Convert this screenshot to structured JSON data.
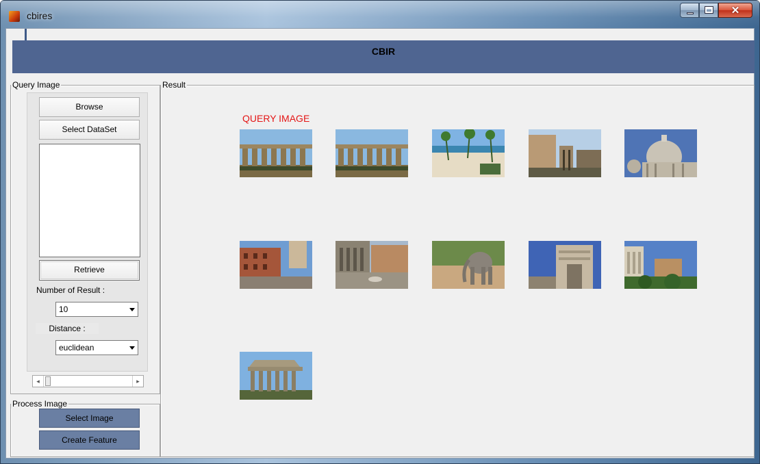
{
  "window": {
    "title": "cbires"
  },
  "banner": {
    "title": "CBIR"
  },
  "query_panel": {
    "label": "Query Image",
    "browse_label": "Browse",
    "select_dataset_label": "Select DataSet",
    "retrieve_label": "Retrieve",
    "number_of_result_label": "Number of Result :",
    "number_of_result_value": "10",
    "distance_label": "Distance :",
    "distance_value": "euclidean"
  },
  "process_panel": {
    "label": "Process Image",
    "select_image_label": "Select Image",
    "create_feature_label": "Create Feature"
  },
  "result_panel": {
    "label": "Result",
    "query_image_label": "QUERY IMAGE",
    "images": [
      {
        "subject": "greek-temple-columns",
        "role": "query"
      },
      {
        "subject": "greek-temple-columns",
        "role": "result"
      },
      {
        "subject": "beach-palm-trees",
        "role": "result"
      },
      {
        "subject": "roman-ruins-street",
        "role": "result"
      },
      {
        "subject": "domed-basilica",
        "role": "result"
      },
      {
        "subject": "spanish-steps-crowd",
        "role": "result"
      },
      {
        "subject": "pantheon-piazza",
        "role": "result"
      },
      {
        "subject": "elephant",
        "role": "result"
      },
      {
        "subject": "triumphal-arch",
        "role": "result"
      },
      {
        "subject": "hilltop-ruins",
        "role": "result"
      },
      {
        "subject": "temple-ruins-sky",
        "role": "result"
      }
    ]
  },
  "colors": {
    "banner": "#4f6591",
    "dark_button": "#6a7fa3",
    "query_label": "#e41515",
    "client_bg": "#f0f0f0"
  }
}
